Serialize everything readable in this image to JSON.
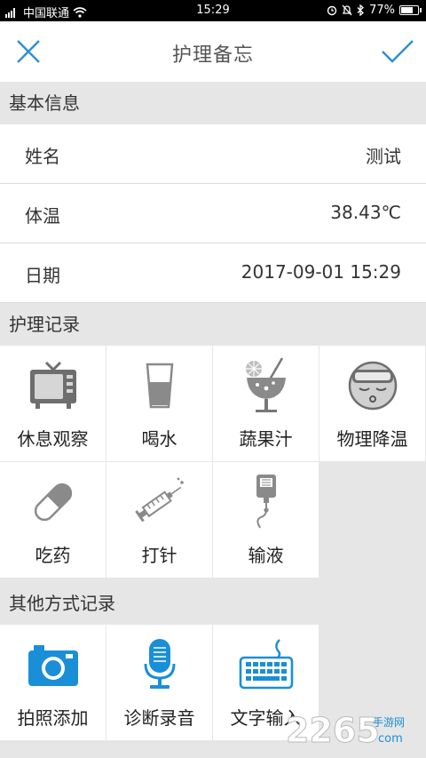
{
  "status": {
    "carrier": "中国联通",
    "time": "15:29",
    "battery": "77%",
    "battery_level": 0.77
  },
  "header": {
    "title": "护理备忘",
    "close_icon": "close-icon",
    "confirm_icon": "check-icon",
    "accent": "#2a8fd6"
  },
  "basic": {
    "heading": "基本信息",
    "rows": [
      {
        "label": "姓名",
        "value": "测试"
      },
      {
        "label": "体温",
        "value": "38.43℃"
      },
      {
        "label": "日期",
        "value": "2017-09-01 15:29"
      }
    ]
  },
  "care": {
    "heading": "护理记录",
    "items": [
      {
        "label": "休息观察",
        "icon": "tv-icon"
      },
      {
        "label": "喝水",
        "icon": "water-glass-icon"
      },
      {
        "label": "蔬果汁",
        "icon": "juice-icon"
      },
      {
        "label": "物理降温",
        "icon": "cold-towel-face-icon"
      },
      {
        "label": "吃药",
        "icon": "pill-icon"
      },
      {
        "label": "打针",
        "icon": "syringe-icon"
      },
      {
        "label": "输液",
        "icon": "iv-drip-icon"
      }
    ]
  },
  "other": {
    "heading": "其他方式记录",
    "items": [
      {
        "label": "拍照添加",
        "icon": "camera-icon"
      },
      {
        "label": "诊断录音",
        "icon": "microphone-icon"
      },
      {
        "label": "文字输入",
        "icon": "keyboard-icon"
      }
    ]
  },
  "watermark": {
    "text": "2265",
    "sub": "手游网",
    "domain": "com"
  }
}
